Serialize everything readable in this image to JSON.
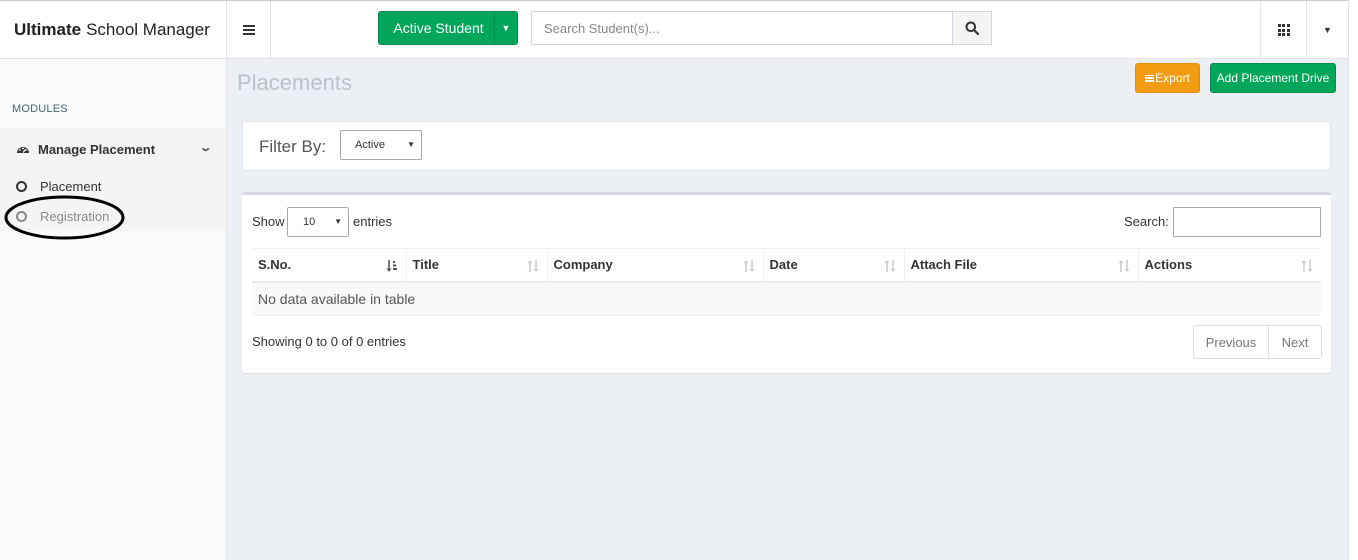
{
  "header": {
    "brand_bold": "Ultimate",
    "brand_rest": "School Manager",
    "student_filter_label": "Active Student",
    "search_placeholder": "Search Student(s)...",
    "colors": {
      "green": "#00a65a",
      "orange": "#f39c12"
    }
  },
  "sidebar": {
    "section_label": "MODULES",
    "group": {
      "label": "Manage Placement",
      "icon": "dashboard-icon",
      "items": [
        {
          "label": "Placement"
        },
        {
          "label": "Registration",
          "highlighted": true
        }
      ]
    }
  },
  "main": {
    "title": "Placements",
    "export_label": "Export",
    "add_label": "Add Placement Drive",
    "filter": {
      "label": "Filter By:",
      "selected": "Active"
    },
    "table": {
      "show_label": "Show",
      "page_length": "10",
      "entries_label": "entries",
      "search_label": "Search:",
      "columns": [
        "S.No.",
        "Title",
        "Company",
        "Date",
        "Attach File",
        "Actions"
      ],
      "empty_message": "No data available in table",
      "info": "Showing 0 to 0 of 0 entries",
      "prev_label": "Previous",
      "next_label": "Next"
    }
  }
}
